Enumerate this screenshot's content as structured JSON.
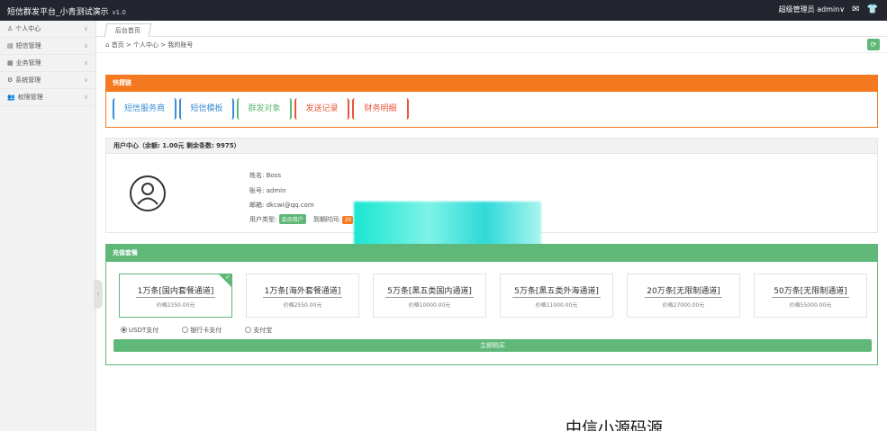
{
  "topbar": {
    "title": "短信群发平台_小青测试演示",
    "version": "v1.0",
    "role": "超级管理员",
    "user": "admin",
    "user_chevron": "∨",
    "mail_icon": "mail-icon",
    "shirt_icon": "shirt-icon"
  },
  "sidebar": {
    "items": [
      {
        "icon": "person-icon",
        "label": "个人中心"
      },
      {
        "icon": "sms-icon",
        "label": "短信管理"
      },
      {
        "icon": "business-icon",
        "label": "业务管理"
      },
      {
        "icon": "settings-icon",
        "label": "系统管理"
      },
      {
        "icon": "users-icon",
        "label": "权限管理"
      }
    ]
  },
  "tabs": [
    {
      "label": "后台首页"
    }
  ],
  "breadcrumb": "首页 > 个人中心 > 我的账号",
  "quick_nav": {
    "title": "快捷链",
    "buttons": [
      {
        "label": "短信服务商",
        "color": "#3a8ed6"
      },
      {
        "label": "短信模板",
        "color": "#3a8ed6"
      },
      {
        "label": "群发对象",
        "color": "#5fb878"
      },
      {
        "label": "发送记录",
        "color": "#e8573a"
      },
      {
        "label": "财务明细",
        "color": "#e8573a"
      }
    ]
  },
  "user_center": {
    "header": "用户中心（余额: 1.00元 剩余条数: 9975）",
    "name": "姓名: Boss",
    "account": "账号: admin",
    "email": "邮箱: dkcwi@qq.com",
    "type_label": "用户类型:",
    "type_badge": "会员用户",
    "expire_label": "到期时间:",
    "expire_badge": "20"
  },
  "recharge": {
    "title": "充值套餐",
    "packages": [
      {
        "name": "1万条[国内套餐通道]",
        "price": "价格2350.00元",
        "selected": true
      },
      {
        "name": "1万条[海外套餐通道]",
        "price": "价格2550.00元",
        "selected": false
      },
      {
        "name": "5万条[黑五类国内通道]",
        "price": "价格10000.00元",
        "selected": false
      },
      {
        "name": "5万条[黑五类外海通道]",
        "price": "价格11000.00元",
        "selected": false
      },
      {
        "name": "20万条[无限制通道]",
        "price": "价格27000.00元",
        "selected": false
      },
      {
        "name": "50万条[无限制通道]",
        "price": "价格55000.00元",
        "selected": false
      }
    ],
    "payments": [
      {
        "label": "USDT支付",
        "checked": true
      },
      {
        "label": "银行卡支付",
        "checked": false
      },
      {
        "label": "支付宝",
        "checked": false
      }
    ],
    "buy_label": "立即购买"
  },
  "bottom_text": "中信小源码源"
}
